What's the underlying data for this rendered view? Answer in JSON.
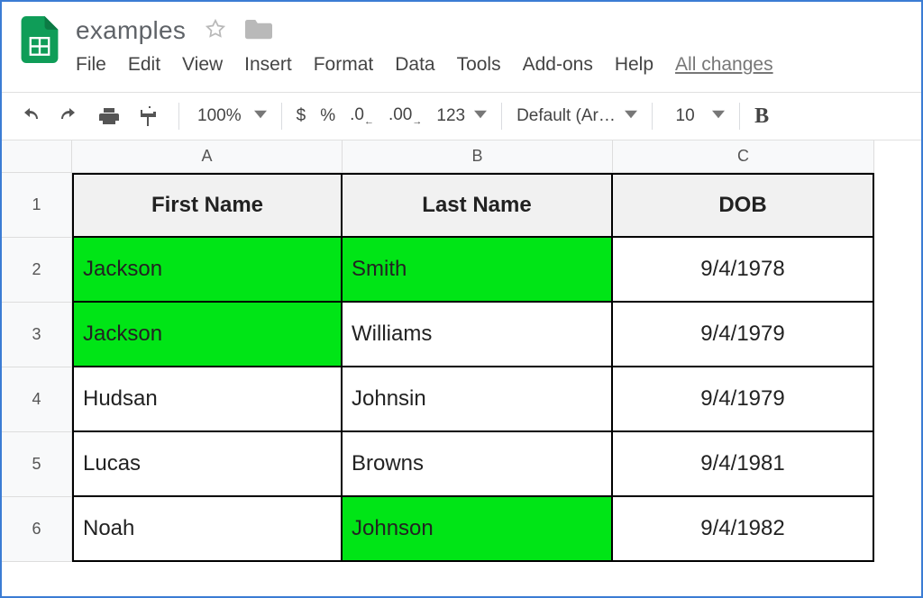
{
  "doc": {
    "title": "examples"
  },
  "menu": {
    "file": "File",
    "edit": "Edit",
    "view": "View",
    "insert": "Insert",
    "format": "Format",
    "data": "Data",
    "tools": "Tools",
    "addons": "Add-ons",
    "help": "Help",
    "changes": "All changes"
  },
  "toolbar": {
    "zoom": "100%",
    "currency": "$",
    "percent": "%",
    "dec_dec": ".0",
    "dec_inc": ".00",
    "more_num": "123",
    "font": "Default (Ari…",
    "size": "10",
    "bold": "B"
  },
  "columns": {
    "a": "A",
    "b": "B",
    "c": "C"
  },
  "headers": [
    "First Name",
    "Last Name",
    "DOB"
  ],
  "rownums": [
    "1",
    "2",
    "3",
    "4",
    "5",
    "6"
  ],
  "data": [
    {
      "a": "Jackson",
      "b": "Smith",
      "c": "9/4/1978",
      "hl_a": true,
      "hl_b": true
    },
    {
      "a": "Jackson",
      "b": "Williams",
      "c": "9/4/1979",
      "hl_a": true,
      "hl_b": false
    },
    {
      "a": "Hudsan",
      "b": "Johnsin",
      "c": "9/4/1979",
      "hl_a": false,
      "hl_b": false
    },
    {
      "a": "Lucas",
      "b": "Browns",
      "c": "9/4/1981",
      "hl_a": false,
      "hl_b": false
    },
    {
      "a": "Noah",
      "b": "Johnson",
      "c": "9/4/1982",
      "hl_a": false,
      "hl_b": true
    }
  ],
  "colors": {
    "highlight": "#00e516",
    "brand": "#0f9d58"
  }
}
